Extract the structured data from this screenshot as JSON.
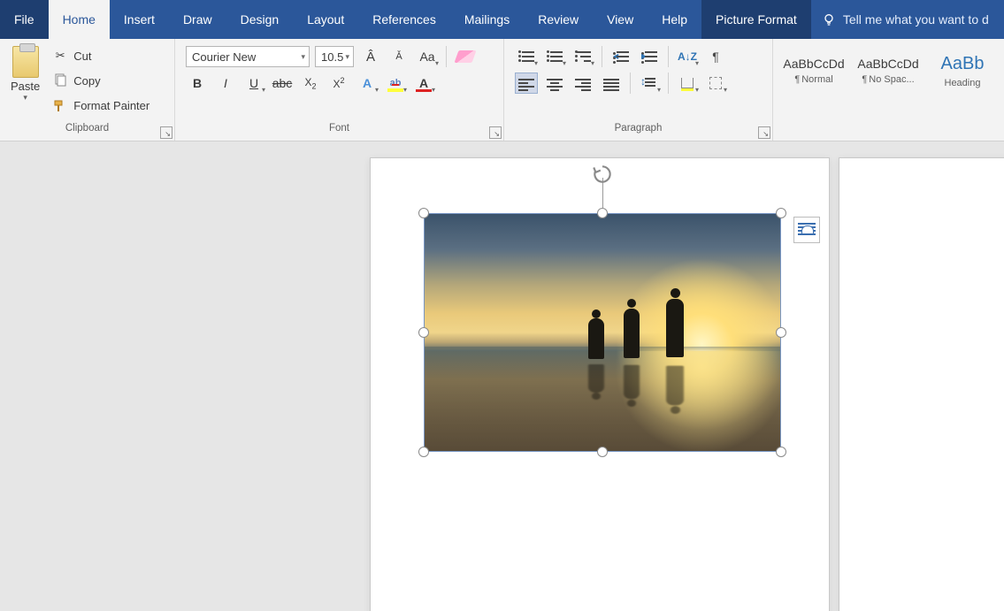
{
  "tabs": {
    "file": "File",
    "items": [
      "Home",
      "Insert",
      "Draw",
      "Design",
      "Layout",
      "References",
      "Mailings",
      "Review",
      "View",
      "Help"
    ],
    "context": "Picture Format",
    "tellme": "Tell me what you want to d"
  },
  "clipboard": {
    "paste": "Paste",
    "cut": "Cut",
    "copy": "Copy",
    "format_painter": "Format Painter",
    "group": "Clipboard"
  },
  "font": {
    "name": "Courier New",
    "size": "10.5",
    "group": "Font"
  },
  "paragraph": {
    "group": "Paragraph"
  },
  "styles": {
    "items": [
      {
        "preview": "AaBbCcDd",
        "name": "Normal",
        "pilcrow": true
      },
      {
        "preview": "AaBbCcDd",
        "name": "No Spac...",
        "pilcrow": true
      },
      {
        "preview": "AaBb",
        "name": "Heading",
        "heading": true
      }
    ]
  }
}
